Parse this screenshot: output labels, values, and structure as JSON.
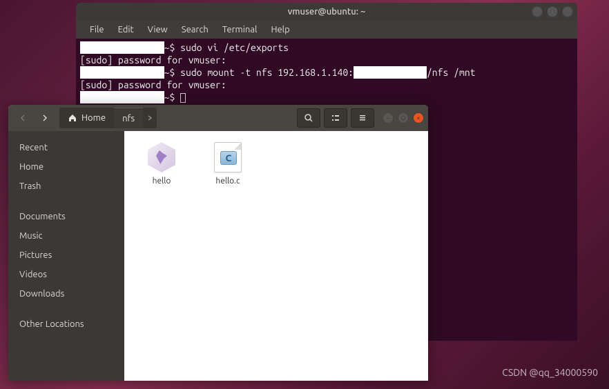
{
  "terminal": {
    "title": "vmuser@ubuntu: ~",
    "menu": {
      "file": "File",
      "edit": "Edit",
      "view": "View",
      "search": "Search",
      "terminal": "Terminal",
      "help": "Help"
    },
    "lines": {
      "l1_prompt": "~$ ",
      "l1_cmd": "sudo vi /etc/exports",
      "l2": "[sudo] password for vmuser:",
      "l3_prompt": "~$ ",
      "l3_cmd_a": "sudo mount -t nfs 192.168.1.140:",
      "l3_cmd_b": "/nfs /mnt",
      "l4": "[sudo] password for vmuser:",
      "l5_prompt": "~$ "
    }
  },
  "fm": {
    "breadcrumb": {
      "home": "Home",
      "current": "nfs"
    },
    "sidebar": {
      "recent": "Recent",
      "home": "Home",
      "trash": "Trash",
      "documents": "Documents",
      "music": "Music",
      "pictures": "Pictures",
      "videos": "Videos",
      "downloads": "Downloads",
      "other": "Other Locations"
    },
    "files": {
      "hello": "hello",
      "hello_c": "hello.c",
      "c_badge": "C"
    }
  },
  "watermark": "CSDN @qq_34000590"
}
